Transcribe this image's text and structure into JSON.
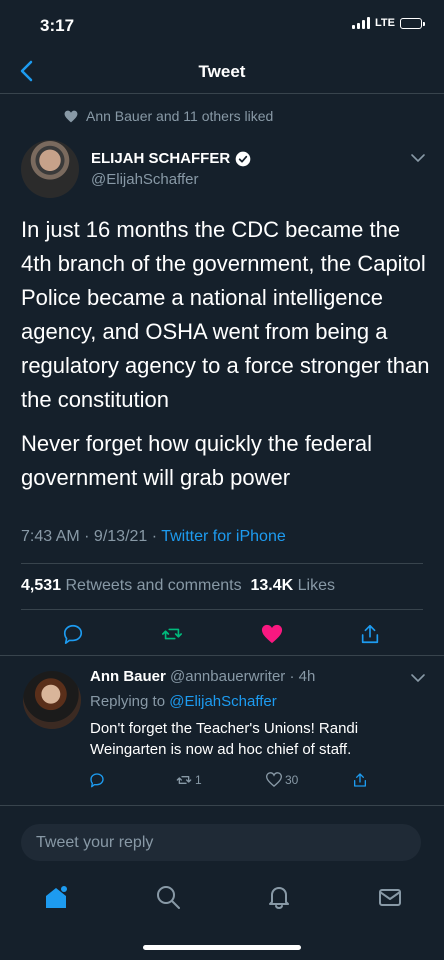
{
  "status_bar": {
    "time": "3:17",
    "network": "LTE"
  },
  "nav": {
    "title": "Tweet"
  },
  "social_context": "Ann Bauer and 11 others liked",
  "tweet": {
    "author_name": "ELIJAH SCHAFFER",
    "author_handle": "@ElijahSchaffer",
    "paragraph_1": "In just 16 months the CDC became the 4th branch of the government, the Capitol Police became a national intelligence agency, and OSHA went from being a regulatory agency to a force stronger than the constitution",
    "paragraph_2": "Never forget how quickly the federal government will grab power",
    "time": "7:43 AM · 9/13/21 · ",
    "source": "Twitter for iPhone",
    "retweets_count": "4,531",
    "retweets_label": "Retweets and comments",
    "likes_count": "13.4K",
    "likes_label": "Likes"
  },
  "reply": {
    "author_name": "Ann Bauer",
    "author_handle_time": "@annbauerwriter · 4h",
    "replying_to_label": "Replying to ",
    "replying_to_handle": "@ElijahSchaffer",
    "text": "Don't forget the Teacher's Unions! Randi Weingarten is now ad hoc chief of staff.",
    "retweet_count": "1",
    "like_count": "30"
  },
  "compose": {
    "placeholder": "Tweet your reply"
  },
  "colors": {
    "background": "#15202b",
    "accent": "#1d9bf0",
    "like": "#f91880",
    "retweet": "#00ba7c",
    "muted": "#8899a6"
  },
  "icons": [
    "back-icon",
    "verified-icon",
    "chevron-down-icon",
    "reply-icon",
    "retweet-icon",
    "heart-icon",
    "share-icon",
    "home-icon",
    "search-icon",
    "notifications-icon",
    "messages-icon"
  ]
}
